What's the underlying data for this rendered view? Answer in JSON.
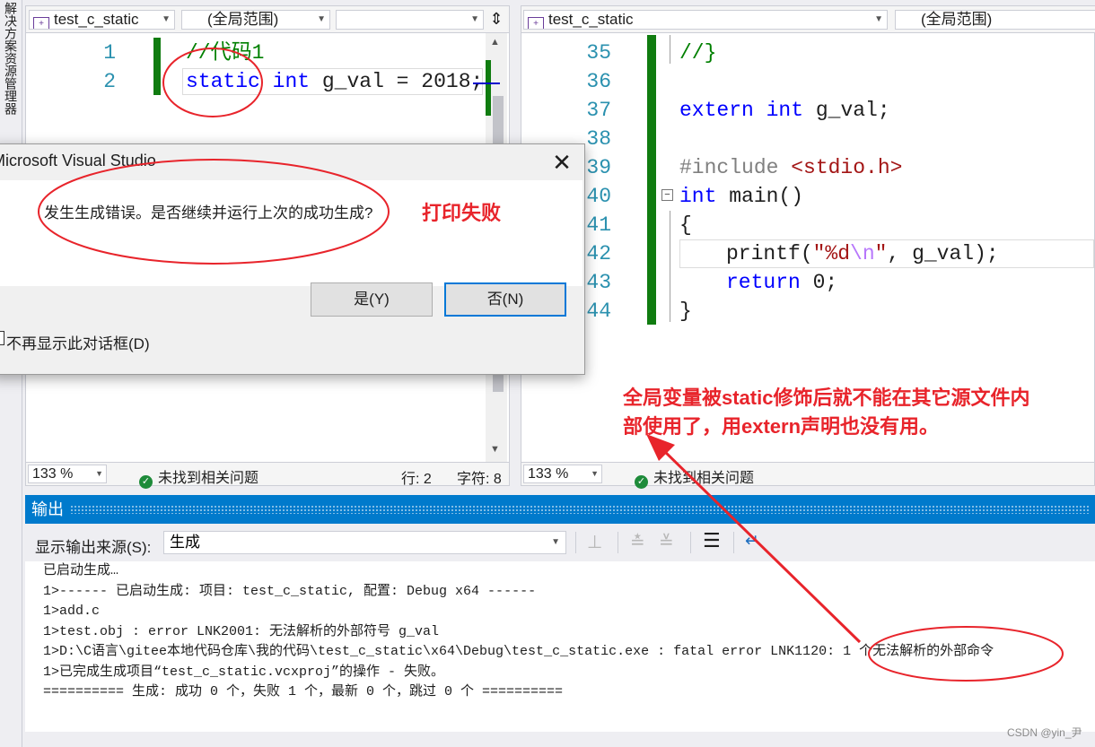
{
  "side_strip": {
    "label": "解决方案资源管理器"
  },
  "left_pane": {
    "file_combo": "test_c_static",
    "scope_combo": "(全局范围)",
    "member_combo": "",
    "lines": [
      {
        "num": "1",
        "text": "//代码1"
      },
      {
        "num": "2",
        "tokens": {
          "kw1": "static",
          "kw2": "int",
          "rest": " g_val = 2018;"
        }
      }
    ],
    "status": {
      "zoom": "133 %",
      "issues": "未找到相关问题",
      "row": "行: 2",
      "char": "字符: 8"
    }
  },
  "right_pane": {
    "file_combo": "test_c_static",
    "scope_combo": "(全局范围)",
    "lines": [
      {
        "num": "35",
        "text": "//}"
      },
      {
        "num": "36",
        "text": ""
      },
      {
        "num": "37",
        "kw": "extern int",
        "rest": " g_val;"
      },
      {
        "num": "38",
        "text": ""
      },
      {
        "num": "39",
        "pp": "#include",
        "inc": " <stdio.h>"
      },
      {
        "num": "40",
        "kw": "int",
        "rest": " main()"
      },
      {
        "num": "41",
        "text": "{"
      },
      {
        "num": "42",
        "fn": "printf(",
        "str1": "\"%d",
        "esc": "\\n",
        "str2": "\"",
        "rest": ", g_val);"
      },
      {
        "num": "43",
        "kw": "return",
        "rest": " 0;"
      },
      {
        "num": "44",
        "text": "}"
      }
    ],
    "status": {
      "zoom": "133 %",
      "issues": "未找到相关问题"
    }
  },
  "dialog": {
    "title": "Microsoft Visual Studio",
    "message": "发生生成错误。是否继续并运行上次的成功生成?",
    "yes_button": "是(Y)",
    "no_button": "否(N)",
    "checkbox_label": "不再显示此对话框(D)"
  },
  "annotations": {
    "print_failed": "打印失败",
    "explanation_line1": "全局变量被static修饰后就不能在其它源文件内",
    "explanation_line2": "部使用了，用extern声明也没有用。"
  },
  "output": {
    "title": "输出",
    "source_label": "显示输出来源(S):",
    "source_value": "生成",
    "lines": [
      "已启动生成…",
      "1>------ 已启动生成: 项目: test_c_static, 配置: Debug x64 ------",
      "1>add.c",
      "1>test.obj : error LNK2001: 无法解析的外部符号 g_val",
      "1>D:\\C语言\\gitee本地代码仓库\\我的代码\\test_c_static\\x64\\Debug\\test_c_static.exe : fatal error LNK1120: 1 个无法解析的外部命令",
      "1>已完成生成项目“test_c_static.vcxproj”的操作 - 失败。",
      "========== 生成: 成功 0 个，失败 1 个，最新 0 个，跳过 0 个 =========="
    ]
  },
  "watermark": "CSDN @yin_尹",
  "colors": {
    "accent": "#007acc",
    "keyword": "#0000ff",
    "comment": "#008000",
    "line_number": "#2b91af",
    "annotation": "#e8242b",
    "change_bar": "#107c10"
  }
}
